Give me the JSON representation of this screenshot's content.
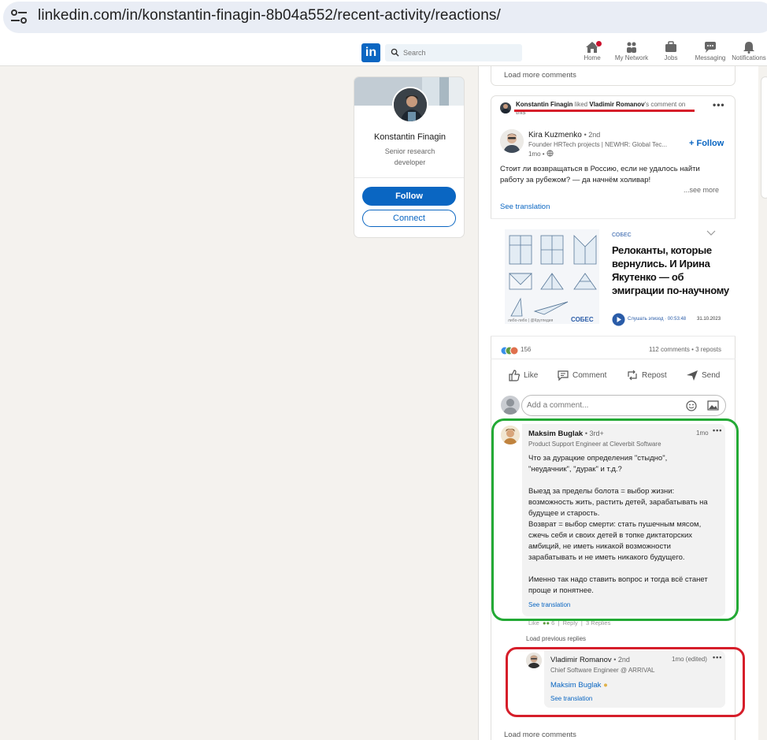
{
  "browser": {
    "url": "linkedin.com/in/konstantin-finagin-8b04a552/recent-activity/reactions/"
  },
  "nav": {
    "logo_text": "in",
    "search_placeholder": "Search",
    "items": [
      {
        "label": "Home",
        "icon": "home-icon"
      },
      {
        "label": "My Network",
        "icon": "network-icon"
      },
      {
        "label": "Jobs",
        "icon": "briefcase-icon"
      },
      {
        "label": "Messaging",
        "icon": "messaging-icon"
      },
      {
        "label": "Notifications",
        "icon": "bell-icon"
      }
    ]
  },
  "profile": {
    "name": "Konstantin Finagin",
    "title": "Senior research developer",
    "follow_label": "Follow",
    "connect_label": "Connect"
  },
  "feed": {
    "prev_load_more": "Load more comments",
    "activity": {
      "actor": "Konstantin Finagin",
      "verb": "liked",
      "target": "Vladimir Romanov",
      "suffix": "'s comment on",
      "suffix2": "this"
    },
    "post": {
      "author": "Kira Kuzmenko",
      "degree": "• 2nd",
      "headline": "Founder HRTech projects | NEWHR: Global Tec...",
      "time": "1mo •",
      "follow_label": "+ Follow",
      "text_line1": "Стоит ли возвращаться в Россию, если не удалось найти",
      "text_line2": "работу за рубежом? — да начнём холивар!",
      "see_more": "...see more",
      "see_translation": "See translation",
      "media": {
        "brand_small": "СОБЕС",
        "title": "Релоканты, которые вернулись. И Ирина Якутенко — об эмиграции по-научному",
        "listen": "Слушать эпизод · 00:53:48",
        "date": "31.10.2023",
        "brand": "СОБЕС",
        "caption": "либо-либо | @Кругпедия"
      },
      "reactions_count": "156",
      "comments_reposts": "112 comments • 3 reposts",
      "actions": [
        "Like",
        "Comment",
        "Repost",
        "Send"
      ],
      "comment_placeholder": "Add a comment..."
    },
    "comment": {
      "author": "Maksim Buglak",
      "degree": "• 3rd+",
      "headline": "Product Support Engineer at Cleverbit Software",
      "time": "1mo",
      "body": [
        "Что за дурацкие определения \"стыдно\",",
        "\"неудачник\", \"дурак\" и т.д.?",
        "",
        "Выезд за пределы болота = выбор жизни:",
        "возможность жить, растить детей, зарабатывать на",
        "будущее и старость.",
        "Возврат = выбор смерти: стать пушечным мясом,",
        "сжечь себя и своих детей в топке диктаторских",
        "амбиций, не иметь никакой возможности",
        "зарабатывать и не иметь никакого будущего.",
        "",
        "Именно так надо ставить вопрос и тогда всё станет",
        "проще и понятнее."
      ],
      "see_translation": "See translation",
      "like": "Like",
      "reaction_count": "6",
      "reply": "Reply",
      "replies": "3 Replies",
      "load_previous": "Load previous replies"
    },
    "reply": {
      "author": "Vladimir Romanov",
      "degree": "• 2nd",
      "headline": "Chief Software Engineer @ ARRIVAL",
      "time": "1mo (edited)",
      "mention": "Maksim Buglak",
      "see_translation": "See translation"
    },
    "load_more_bottom": "Load more comments"
  },
  "colors": {
    "linkedin_blue": "#0a66c2",
    "highlight_green": "#23a935",
    "highlight_red": "#d61e2a"
  }
}
